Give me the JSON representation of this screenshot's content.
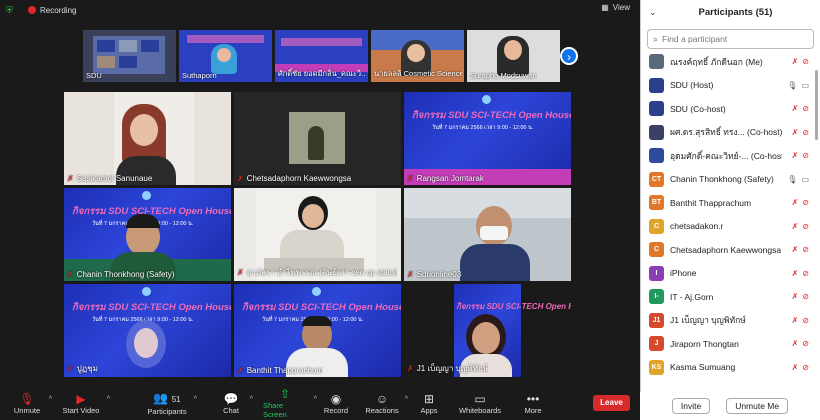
{
  "topbar": {
    "recording": "Recording",
    "view": "View"
  },
  "strip": [
    "SDU",
    "Suthaporn",
    "ศักดิ์ชัย ยอดมีกลิ่น_คณะวิ...",
    "นายลลลิ Cosmetic Science",
    "Surapha Modsuwan"
  ],
  "tiles": [
    {
      "name": "Sasikamol Sanunaue",
      "type": "photo"
    },
    {
      "name": "Chetsadaphorn Kaewwongsa",
      "type": "photo"
    },
    {
      "name": "Rangsan Jomtarak",
      "type": "banner"
    },
    {
      "name": "Chanin Thonkhong (Safety)",
      "type": "banner"
    },
    {
      "name": "อาภัสรา อำไพพรรณ (ศิษย์เก่า ceo cp stain&tic l...",
      "type": "photo"
    },
    {
      "name": "Sduonline03",
      "type": "photo"
    },
    {
      "name": "ปูฏชุม",
      "type": "banner"
    },
    {
      "name": "Banthit Thapprachum",
      "type": "banner"
    },
    {
      "name": "J1 เบ็ญญา บุญพิทักษ์",
      "type": "banner"
    }
  ],
  "banner": {
    "title": "กิจกรรม SDU SCI-TECH Open House 2023",
    "subtitle": "วันที่ 7 มกราคม 2566 เวลา 9:00 - 12:00 น."
  },
  "toolbar": {
    "unmute": "Unmute",
    "start_video": "Start Video",
    "participants": "Participants",
    "participants_count": "51",
    "chat": "Chat",
    "share": "Share Screen",
    "record": "Record",
    "reactions": "Reactions",
    "apps": "Apps",
    "whiteboards": "Whiteboards",
    "more": "More",
    "leave": "Leave"
  },
  "panel": {
    "title": "Participants (51)",
    "search_placeholder": "Find a participant",
    "invite": "Invite",
    "unmute_me": "Unmute Me"
  },
  "participants": [
    {
      "name": "ณรงค์ฤทธิ์ ภักดีนอก (Me)",
      "initials": "",
      "color": "#5a6a7a",
      "img": true
    },
    {
      "name": "SDU (Host)",
      "initials": "",
      "color": "#2c3f8a",
      "img": true
    },
    {
      "name": "SDU (Co-host)",
      "initials": "",
      "color": "#2c3f8a",
      "img": true
    },
    {
      "name": "ผศ.ดร.สุรสิทธิ์ ทรง...  (Co-host)",
      "initials": "",
      "color": "#3a3f66",
      "img": true
    },
    {
      "name": "อุดมศักดิ์-คณะวิทย์-...  (Co-host)",
      "initials": "",
      "color": "#2e4a9a",
      "img": true
    },
    {
      "name": "Chanin Thonkhong (Safety)",
      "initials": "CT",
      "color": "#e0772a"
    },
    {
      "name": "Banthit Thapprachum",
      "initials": "BT",
      "color": "#e0772a"
    },
    {
      "name": "chetsadakon.r",
      "initials": "C",
      "color": "#e0a42a"
    },
    {
      "name": "Chetsadaphorn Kaewwongsa",
      "initials": "C",
      "color": "#e0772a"
    },
    {
      "name": "iPhone",
      "initials": "I",
      "color": "#8a3fb5"
    },
    {
      "name": "IT - Aj.Gorn",
      "initials": "I-",
      "color": "#1f9a5c"
    },
    {
      "name": "J1 เบ็ญญา บุญพิทักษ์",
      "initials": "J1",
      "color": "#d6492d"
    },
    {
      "name": "Jiraporn Thongtan",
      "initials": "J",
      "color": "#d6492d"
    },
    {
      "name": "Kasma Sumuang",
      "initials": "KS",
      "color": "#e0a42a"
    }
  ]
}
